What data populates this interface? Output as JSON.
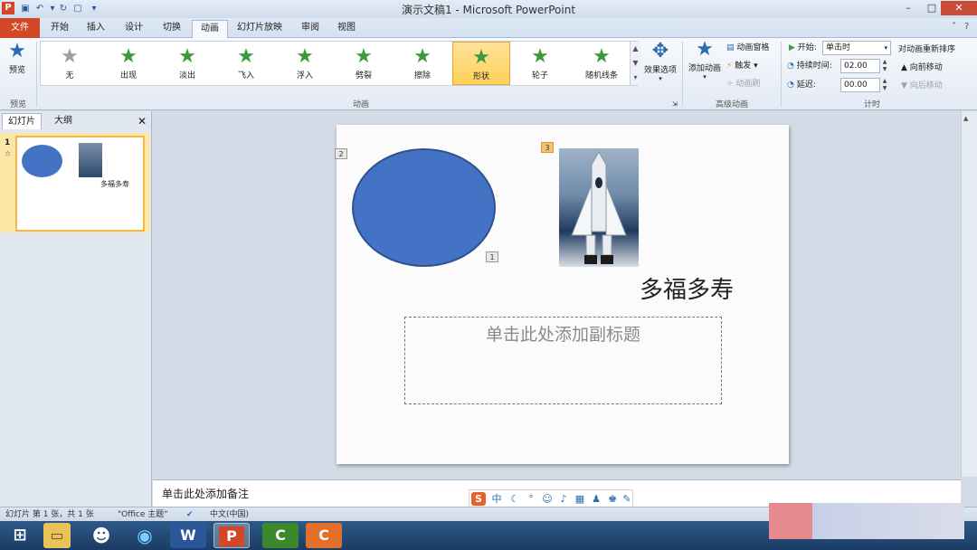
{
  "titlebar": {
    "title": "演示文稿1 - Microsoft PowerPoint",
    "app_icon": "P",
    "min": "–",
    "max": "□",
    "close": "✕"
  },
  "tabs": {
    "file": "文件",
    "items": [
      "开始",
      "插入",
      "设计",
      "切换",
      "动画",
      "幻灯片放映",
      "审阅",
      "视图"
    ],
    "active": "动画"
  },
  "ribbon": {
    "preview": {
      "label": "预览",
      "group": "预览"
    },
    "animation_group": "动画",
    "animations": [
      {
        "label": "无",
        "color": "#9aa0a8"
      },
      {
        "label": "出现",
        "color": "#3c9a3c"
      },
      {
        "label": "淡出",
        "color": "#3c9a3c"
      },
      {
        "label": "飞入",
        "color": "#3c9a3c"
      },
      {
        "label": "浮入",
        "color": "#3c9a3c"
      },
      {
        "label": "劈裂",
        "color": "#3c9a3c"
      },
      {
        "label": "擦除",
        "color": "#3c9a3c"
      },
      {
        "label": "形状",
        "color": "#3c9a3c"
      },
      {
        "label": "轮子",
        "color": "#3c9a3c"
      },
      {
        "label": "随机线条",
        "color": "#3c9a3c"
      }
    ],
    "selected_animation": "形状",
    "effect_options": "效果选项",
    "advanced": {
      "group": "高级动画",
      "add_animation": "添加动画",
      "animation_pane": "动画窗格",
      "trigger": "触发",
      "animation_painter": "动画刷"
    },
    "timing": {
      "group": "计时",
      "start_label": "开始:",
      "start_value": "单击时",
      "duration_label": "持续时间:",
      "duration_value": "02.00",
      "delay_label": "延迟:",
      "delay_value": "00.00",
      "reorder_title": "对动画重新排序",
      "move_earlier": "向前移动",
      "move_later": "向后移动"
    }
  },
  "left_pane": {
    "tab_slides": "幻灯片",
    "tab_outline": "大纲",
    "close": "✕",
    "slide_number": "1",
    "thumb_text": "多福多寿",
    "thumb_star": "☆"
  },
  "slide": {
    "tag_ellipse": "2",
    "tag_one": "1",
    "tag_rocket": "3",
    "motto": "多福多寿",
    "subtitle_placeholder": "单击此处添加副标题"
  },
  "notes_placeholder": "单击此处添加备注",
  "ime": {
    "logo": "S",
    "mode": "中"
  },
  "statusbar": {
    "slide_info": "幻灯片 第 1 张，共 1 张",
    "theme": "\"Office 主题\"",
    "language": "中文(中国)"
  },
  "taskbar": {
    "word": "W",
    "powerpoint": "P",
    "camtasia1": "C",
    "camtasia2": "C"
  }
}
